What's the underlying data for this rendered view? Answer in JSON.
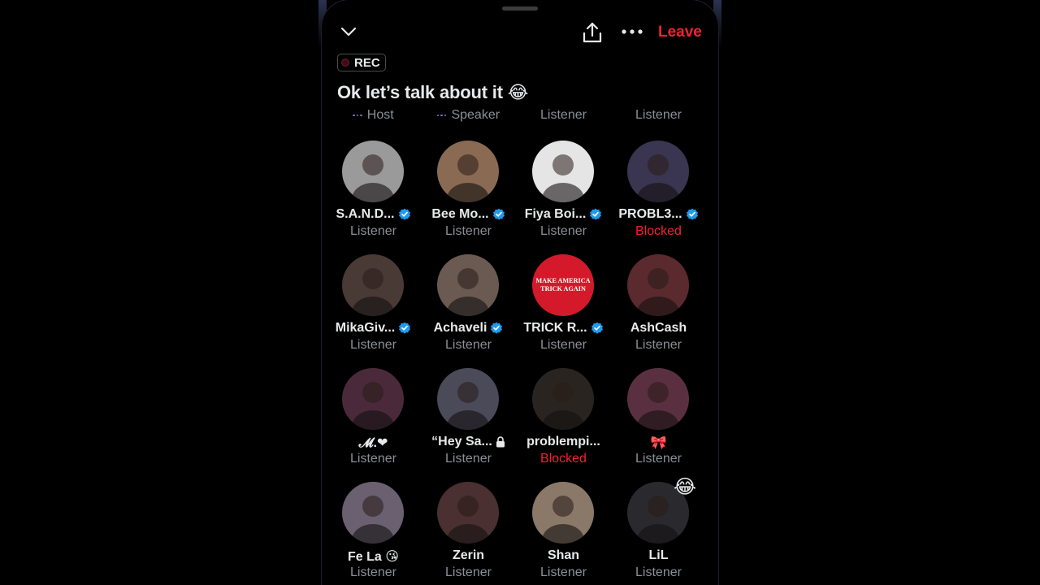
{
  "header": {
    "leave_label": "Leave",
    "rec_label": "REC",
    "title": "Ok let’s talk about it 😂"
  },
  "roles": [
    {
      "label": "Host",
      "has_dots": true
    },
    {
      "label": "Speaker",
      "has_dots": true
    },
    {
      "label": "Listener",
      "has_dots": false
    },
    {
      "label": "Listener",
      "has_dots": false
    }
  ],
  "participants": [
    {
      "name": "S.A.N.D...",
      "verified": true,
      "status": "Listener",
      "blocked": false,
      "avatar_color": "#9a9a9a"
    },
    {
      "name": "Bee Mo...",
      "verified": true,
      "status": "Listener",
      "blocked": false,
      "avatar_color": "#8a6a52"
    },
    {
      "name": "Fiya Boi...",
      "verified": true,
      "status": "Listener",
      "blocked": false,
      "avatar_color": "#e5e5e5"
    },
    {
      "name": "PROBL3...",
      "verified": true,
      "status": "Blocked",
      "blocked": true,
      "avatar_color": "#3a3550"
    },
    {
      "name": "MikaGiv...",
      "verified": true,
      "status": "Listener",
      "blocked": false,
      "avatar_color": "#4a3a36"
    },
    {
      "name": "Achaveli",
      "verified": true,
      "status": "Listener",
      "blocked": false,
      "avatar_color": "#6a5a52"
    },
    {
      "name": "TRICK R...",
      "verified": true,
      "status": "Listener",
      "blocked": false,
      "avatar_color": "#d41a2a",
      "avatar_text": "MAKE AMERICA TRICK AGAIN"
    },
    {
      "name": "AshCash",
      "verified": false,
      "status": "Listener",
      "blocked": false,
      "avatar_color": "#5a2a2e"
    },
    {
      "name": "𝓜.❤",
      "verified": false,
      "status": "Listener",
      "blocked": false,
      "avatar_color": "#4a2a3a"
    },
    {
      "name": "“Hey Sa...",
      "verified": false,
      "locked": true,
      "status": "Listener",
      "blocked": false,
      "avatar_color": "#4a4a58"
    },
    {
      "name": "problempi...",
      "verified": false,
      "status": "Blocked",
      "blocked": true,
      "avatar_color": "#2a2420"
    },
    {
      "name": "🎀",
      "verified": false,
      "status": "Listener",
      "blocked": false,
      "avatar_color": "#5a3040"
    },
    {
      "name": "Fe La 😘",
      "verified": false,
      "status": "Listener",
      "blocked": false,
      "avatar_color": "#6a6070"
    },
    {
      "name": "Zerin",
      "verified": false,
      "status": "Listener",
      "blocked": false,
      "avatar_color": "#4a3030"
    },
    {
      "name": "Shan",
      "verified": false,
      "status": "Listener",
      "blocked": false,
      "avatar_color": "#8a7868"
    },
    {
      "name": "LiL",
      "verified": false,
      "status": "Listener",
      "blocked": false,
      "avatar_color": "#2a2a2e",
      "reaction": "😂"
    }
  ],
  "colors": {
    "accent_red": "#f4212e",
    "verified_blue": "#1d9bf0",
    "muted_text": "#8b8f94",
    "speaking_dots": "#7a6cff"
  },
  "icons": {
    "collapse": "chevron-down-icon",
    "share": "share-icon",
    "more": "more-icon",
    "verified": "verified-badge-icon",
    "lock": "lock-icon"
  }
}
